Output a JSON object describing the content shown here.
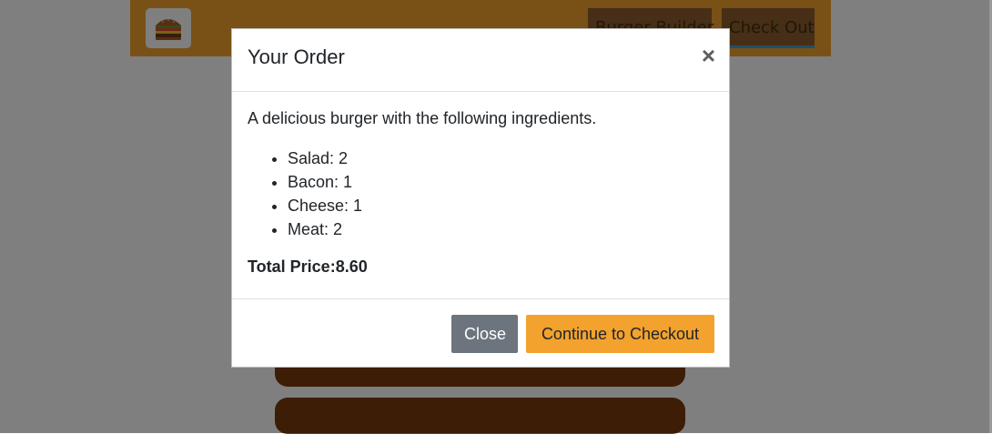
{
  "toolbar": {
    "logo_icon": "burger-logo-icon",
    "nav": [
      {
        "label": "Burger Builder"
      },
      {
        "label": "Check Out"
      }
    ]
  },
  "modal": {
    "title": "Your Order",
    "close_symbol": "×",
    "intro": "A delicious burger with the following ingredients.",
    "ingredients": [
      {
        "name": "Salad",
        "qty": "2",
        "text": "Salad: 2"
      },
      {
        "name": "Bacon",
        "qty": "1",
        "text": "Bacon: 1"
      },
      {
        "name": "Cheese",
        "qty": "1",
        "text": "Cheese: 1"
      },
      {
        "name": "Meat",
        "qty": "2",
        "text": "Meat: 2"
      }
    ],
    "total_label": "Total Price:",
    "total_value": "8.60",
    "total_text": "Total Price:8.60",
    "buttons": {
      "close": "Close",
      "continue": "Continue to Checkout"
    }
  },
  "colors": {
    "accent": "#f3a22d",
    "bun": "#7b3a0d",
    "secondary_button": "#6c757d"
  }
}
